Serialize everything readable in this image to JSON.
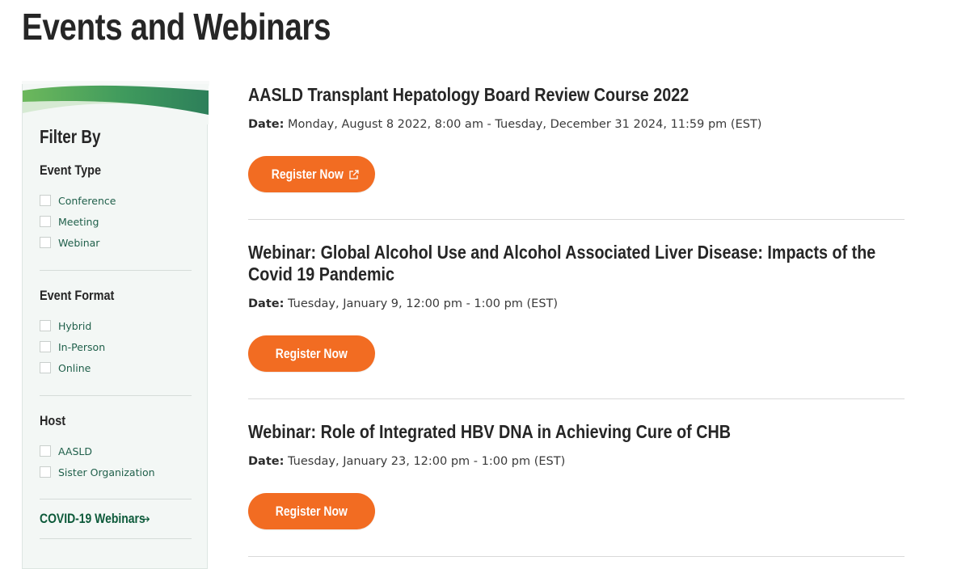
{
  "page": {
    "title": "Events and Webinars"
  },
  "sidebar": {
    "title": "Filter By",
    "groups": [
      {
        "title": "Event Type",
        "options": [
          {
            "label": "Conference",
            "checked": false
          },
          {
            "label": "Meeting",
            "checked": false
          },
          {
            "label": "Webinar",
            "checked": false
          }
        ]
      },
      {
        "title": "Event Format",
        "options": [
          {
            "label": "Hybrid",
            "checked": false
          },
          {
            "label": "In-Person",
            "checked": false
          },
          {
            "label": "Online",
            "checked": false
          }
        ]
      },
      {
        "title": "Host",
        "options": [
          {
            "label": "AASLD",
            "checked": false
          },
          {
            "label": "Sister Organization",
            "checked": false
          }
        ]
      }
    ],
    "covid_link": {
      "label": "COVID-19 Webinars",
      "icon": "arrow-right-icon"
    }
  },
  "events": [
    {
      "title": "AASLD Transplant Hepatology Board Review Course 2022",
      "date_label": "Date:",
      "date": "Monday, August 8 2022, 8:00 am - Tuesday, December 31 2024, 11:59 pm (EST)",
      "button_label": "Register Now",
      "external": true
    },
    {
      "title": "Webinar: Global Alcohol Use and Alcohol Associated Liver Disease: Impacts of the Covid 19 Pandemic",
      "date_label": "Date:",
      "date": "Tuesday, January 9, 12:00 pm - 1:00 pm (EST)",
      "button_label": "Register Now",
      "external": false
    },
    {
      "title": "Webinar: Role of Integrated HBV DNA in Achieving Cure of CHB",
      "date_label": "Date:",
      "date": "Tuesday, January 23, 12:00 pm - 1:00 pm (EST)",
      "button_label": "Register Now",
      "external": false
    }
  ],
  "colors": {
    "accent_orange": "#f26c22",
    "brand_green": "#0d5a3a",
    "filter_label_green": "#1f5f4a",
    "sidebar_bg": "#f3f7f5"
  }
}
